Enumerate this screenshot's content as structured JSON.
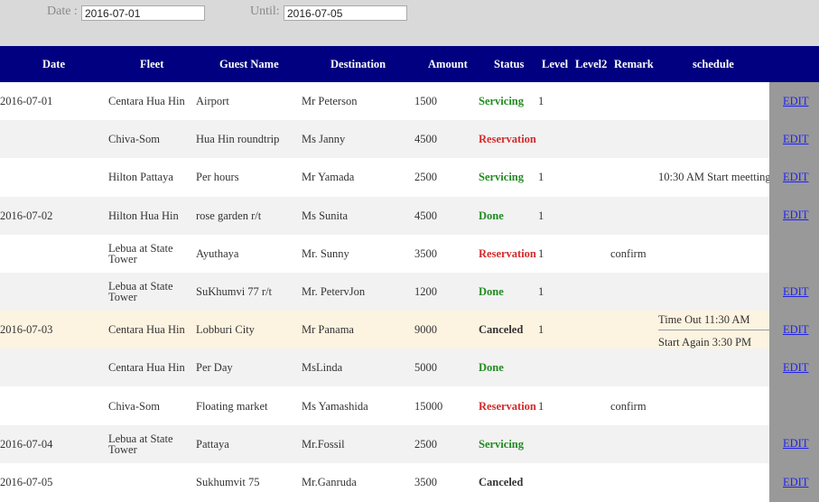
{
  "filters": {
    "date_label": "Date :",
    "date_value": "2016-07-01",
    "until_label": "Until:",
    "until_value": "2016-07-05"
  },
  "columns": [
    "Date",
    "Fleet",
    "Guest Name",
    "Destination",
    "Amount",
    "Status",
    "Level",
    "Level2",
    "Remark",
    "schedule"
  ],
  "edit_label": "EDIT",
  "colors": {
    "header_bg": "#000080",
    "status_green": "#228b22",
    "status_red": "#d22b2b",
    "link": "#2222ee"
  },
  "rows": [
    {
      "date": "2016-07-01",
      "fleet": "Centara Hua Hin",
      "guest": "Airport",
      "dest": "Mr Peterson",
      "amount": "1500",
      "status": "Servicing",
      "level": "1",
      "remark": "",
      "schedule": "",
      "edit": true
    },
    {
      "date": "",
      "fleet": "Chiva-Som",
      "guest": "Hua Hin roundtrip",
      "dest": "Ms Janny",
      "amount": "4500",
      "status": "Reservation",
      "level": "",
      "remark": "",
      "schedule": "",
      "edit": true
    },
    {
      "date": "",
      "fleet": "Hilton Pattaya",
      "guest": "Per hours",
      "dest": "Mr Yamada",
      "amount": "2500",
      "status": "Servicing",
      "level": "1",
      "remark": "",
      "schedule": "10:30 AM Start meetting",
      "edit": true
    },
    {
      "date": "2016-07-02",
      "fleet": "Hilton Hua Hin",
      "guest": "rose garden r/t",
      "dest": "Ms Sunita",
      "amount": "4500",
      "status": "Done",
      "level": "1",
      "remark": "",
      "schedule": "",
      "edit": true
    },
    {
      "date": "",
      "fleet": "Lebua at State Tower",
      "guest": "Ayuthaya",
      "dest": "Mr. Sunny",
      "amount": "3500",
      "status": "Reservation",
      "level": "1",
      "remark": "confirm",
      "schedule": "",
      "edit": false
    },
    {
      "date": "",
      "fleet": "Lebua at State Tower",
      "guest": "SuKhumvi 77 r/t",
      "dest": "Mr. PetervJon",
      "amount": "1200",
      "status": "Done",
      "level": "1",
      "remark": "",
      "schedule": "",
      "edit": true
    },
    {
      "date": "2016-07-03",
      "fleet": "Centara Hua Hin",
      "guest": "Lobburi City",
      "dest": "Mr Panama",
      "amount": "9000",
      "status": "Canceled",
      "level": "1",
      "remark": "",
      "schedule": "Time Out 11:30 AM",
      "schedule2": "Start Again 3:30 PM",
      "edit": true
    },
    {
      "date": "",
      "fleet": "Centara Hua Hin",
      "guest": "Per Day",
      "dest": "MsLinda",
      "amount": "5000",
      "status": "Done",
      "level": "",
      "remark": "",
      "schedule": "",
      "edit": true
    },
    {
      "date": "",
      "fleet": "Chiva-Som",
      "guest": "Floating market",
      "dest": "Ms Yamashida",
      "amount": "15000",
      "status": "Reservation",
      "level": "1",
      "remark": "confirm",
      "schedule": "",
      "edit": false
    },
    {
      "date": "2016-07-04",
      "fleet": "Lebua at State Tower",
      "guest": "Pattaya",
      "dest": "Mr.Fossil",
      "amount": "2500",
      "status": "Servicing",
      "level": "",
      "remark": "",
      "schedule": "",
      "edit": true
    },
    {
      "date": "2016-07-05",
      "fleet": "",
      "guest": "Sukhumvit 75",
      "dest": "Mr.Ganruda",
      "amount": "3500",
      "status": "Canceled",
      "level": "",
      "remark": "",
      "schedule": "",
      "edit": true
    }
  ]
}
